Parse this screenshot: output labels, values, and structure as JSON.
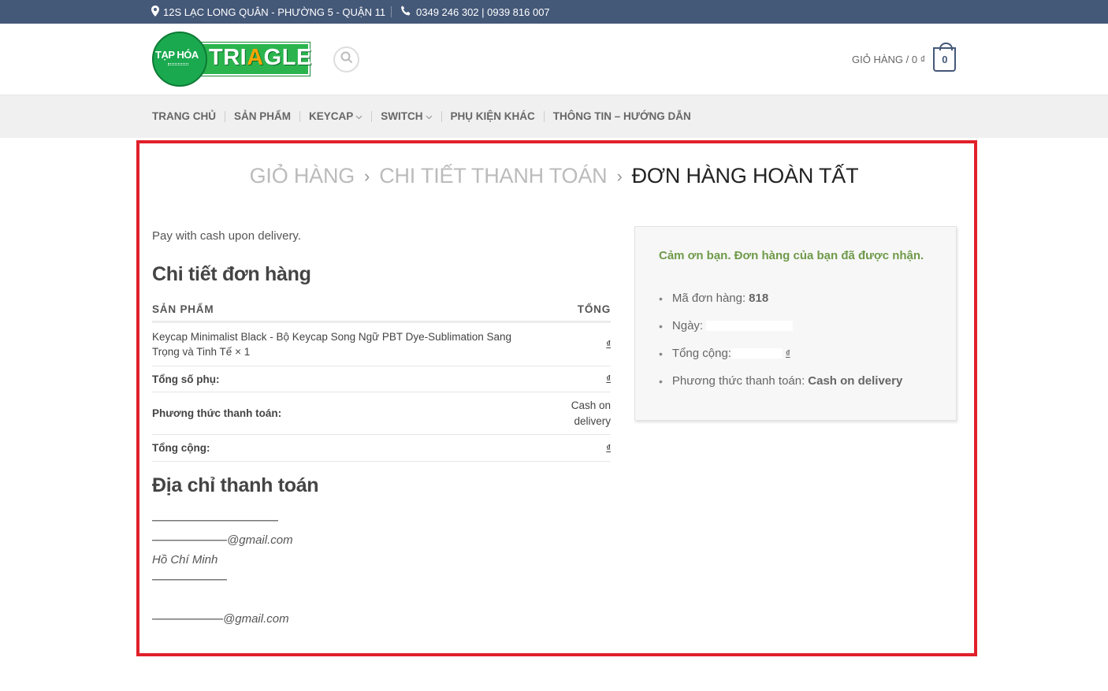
{
  "topbar": {
    "address": "12S LẠC LONG QUÂN - PHƯỜNG 5 - QUẬN 11",
    "phone": "0349 246 302 | 0939 816 007",
    "pin_icon": "map-pin-icon",
    "phone_icon": "phone-icon"
  },
  "header": {
    "logo_small": "TẠP HÓA",
    "logo_main_a": "TRI",
    "logo_main_b": "A",
    "logo_main_c": "GLE",
    "cart_label": "GIỎ HÀNG / 0 ₫",
    "cart_count": "0"
  },
  "nav": {
    "items": [
      {
        "label": "TRANG CHỦ",
        "dropdown": false
      },
      {
        "label": "SẢN PHẨM",
        "dropdown": false
      },
      {
        "label": "KEYCAP",
        "dropdown": true
      },
      {
        "label": "SWITCH",
        "dropdown": true
      },
      {
        "label": "PHỤ KIỆN KHÁC",
        "dropdown": false
      },
      {
        "label": "THÔNG TIN – HƯỚNG DẪN",
        "dropdown": false
      }
    ]
  },
  "breadcrumb": {
    "step1": "GIỎ HÀNG",
    "step2": "CHI TIẾT THANH TOÁN",
    "step3": "ĐƠN HÀNG HOÀN TẤT"
  },
  "order": {
    "pay_note": "Pay with cash upon delivery.",
    "title": "Chi tiết đơn hàng",
    "col_product": "SẢN PHẨM",
    "col_total": "TỔNG",
    "item_name": "Keycap Minimalist Black - Bộ Keycap Song Ngữ PBT Dye-Sublimation Sang Trọng và Tinh Tế",
    "item_qty": "× 1",
    "currency": "₫",
    "subtotal_label": "Tổng số phụ:",
    "payment_label": "Phương thức thanh toán:",
    "payment_value": "Cash on delivery",
    "total_label": "Tổng cộng:"
  },
  "billing": {
    "title": "Địa chỉ thanh toán",
    "email1_suffix": "@gmail.com",
    "city": "Hồ Chí Minh",
    "email2_suffix": "@gmail.com"
  },
  "thanks": {
    "message": "Cảm ơn bạn. Đơn hàng của bạn đã được nhận.",
    "order_no_label": "Mã đơn hàng:",
    "order_no": "818",
    "date_label": "Ngày:",
    "total_label": "Tổng cộng:",
    "currency": "₫",
    "method_label": "Phương thức thanh toán:",
    "method_value": "Cash on delivery"
  },
  "colors": {
    "topbar": "#445878",
    "highlight_frame": "#e0202a",
    "thanks_green": "#6f9a4a"
  }
}
